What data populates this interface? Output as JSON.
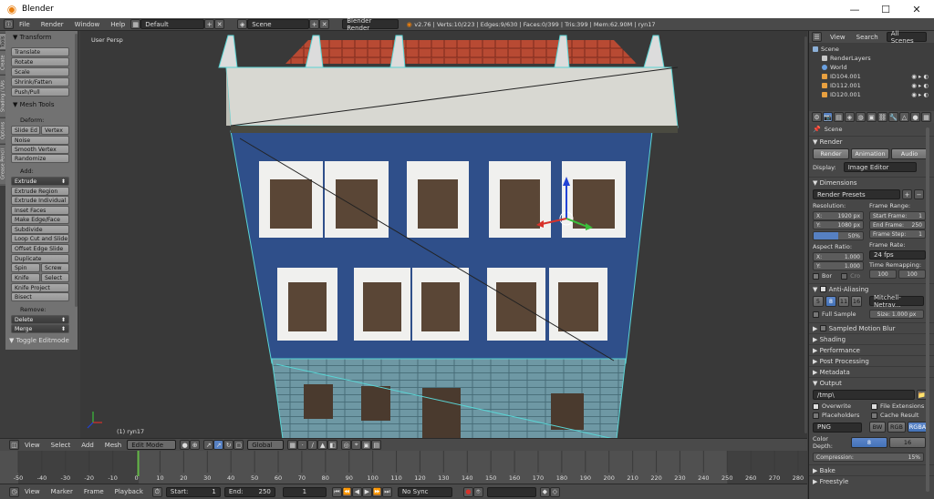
{
  "window": {
    "title": "Blender",
    "minimize": "—",
    "maximize": "☐",
    "close": "✕"
  },
  "topbar": {
    "menus": [
      "File",
      "Render",
      "Window",
      "Help"
    ],
    "layout": "Default",
    "scene": "Scene",
    "engine": "Blender Render",
    "stats": "v2.76 | Verts:10/223 | Edges:9/630 | Faces:0/399 | Tris:399 | Mem:62.90M | ryn17"
  },
  "toolshelf": {
    "tabs": [
      "Tools",
      "Create",
      "Shading / UVs",
      "Options",
      "Grease Pencil"
    ],
    "transform_header": "▼ Transform",
    "transform": [
      "Translate",
      "Rotate",
      "Scale",
      "Shrink/Fatten",
      "Push/Pull"
    ],
    "meshtools_header": "▼ Mesh Tools",
    "deform_label": "Deform:",
    "deform_pair": [
      "Slide Ed",
      "Vertex"
    ],
    "deform": [
      "Noise",
      "Smooth Vertex",
      "Randomize"
    ],
    "add_label": "Add:",
    "add_extrude": "Extrude",
    "add": [
      "Extrude Region",
      "Extrude Individual",
      "Inset Faces",
      "Make Edge/Face",
      "Subdivide",
      "Loop Cut and Slide",
      "Offset Edge Slide",
      "Duplicate"
    ],
    "pair1": [
      "Spin",
      "Screw"
    ],
    "pair2": [
      "Knife",
      "Select"
    ],
    "add_more": [
      "Knife Project",
      "Bisect"
    ],
    "remove_label": "Remove:",
    "remove": [
      "Delete",
      "Merge"
    ],
    "toggle": "▼ Toggle Editmode"
  },
  "viewport": {
    "label": "User Persp",
    "object": "(1) ryn17"
  },
  "vpheader": {
    "menus": [
      "View",
      "Select",
      "Add",
      "Mesh"
    ],
    "mode": "Edit Mode",
    "orientation": "Global"
  },
  "timeline": {
    "ticks": [
      "-50",
      "-40",
      "-30",
      "-20",
      "-10",
      "0",
      "10",
      "20",
      "30",
      "40",
      "50",
      "60",
      "70",
      "80",
      "90",
      "100",
      "110",
      "120",
      "130",
      "140",
      "150",
      "160",
      "170",
      "180",
      "190",
      "200",
      "210",
      "220",
      "230",
      "240",
      "250",
      "260",
      "270",
      "280"
    ],
    "menus": [
      "View",
      "Marker",
      "Frame",
      "Playback"
    ],
    "start": "Start:",
    "start_val": "1",
    "end": "End:",
    "end_val": "250",
    "current": "1",
    "sync": "No Sync",
    "current_frame": 0,
    "frame_min": -50,
    "frame_max": 280
  },
  "outliner": {
    "tabs": [
      "View",
      "Search",
      "All Scenes"
    ],
    "items": [
      "Scene",
      "RenderLayers",
      "World",
      "ID104.001",
      "ID112.001",
      "ID120.001"
    ]
  },
  "props": {
    "context": "Scene",
    "render_header": "Render",
    "render_btns": [
      "Render",
      "Animation",
      "Audio"
    ],
    "display_label": "Display:",
    "display_val": "Image Editor",
    "dimensions": "Dimensions",
    "presets": "Render Presets",
    "resolution": "Resolution:",
    "frame_range": "Frame Range:",
    "res_x": "X:",
    "res_x_val": "1920 px",
    "res_y": "Y:",
    "res_y_val": "1080 px",
    "res_pct": "50%",
    "start_frame": "Start Frame:",
    "start_frame_val": "1",
    "end_frame": "End Frame:",
    "end_frame_val": "250",
    "frame_step": "Frame Step:",
    "frame_step_val": "1",
    "aspect": "Aspect Ratio:",
    "frame_rate": "Frame Rate:",
    "asp_x": "X:",
    "asp_x_val": "1.000",
    "asp_y": "Y:",
    "asp_y_val": "1.000",
    "fps": "24 fps",
    "remap": "Time Remapping:",
    "remap_old": "100",
    "remap_new": "100",
    "bor": "Bor",
    "crop": "Cro",
    "aa": "Anti-Aliasing",
    "aa_samples": [
      "5",
      "8",
      "11",
      "16"
    ],
    "aa_filter": "Mitchell-Netrav...",
    "full_sample": "Full Sample",
    "size": "Size: 1.000 px",
    "collapsed": [
      "Sampled Motion Blur",
      "Shading",
      "Performance",
      "Post Processing",
      "Metadata"
    ],
    "output": "Output",
    "path": "/tmp\\",
    "overwrite": "Overwrite",
    "file_ext": "File Extensions",
    "placeholders": "Placeholders",
    "cache": "Cache Result",
    "format": "PNG",
    "bw": "BW",
    "rgb": "RGB",
    "rgba": "RGBA",
    "color_depth": "Color Depth:",
    "depth8": "8",
    "depth16": "16",
    "compression": "Compression:",
    "compression_val": "15%",
    "bake": "Bake",
    "freestyle": "Freestyle"
  },
  "colors": {
    "accent": "#5680c2",
    "building": "#2f4f8a",
    "roof": "#b84a33",
    "timeline_cursor": "#63b846"
  }
}
